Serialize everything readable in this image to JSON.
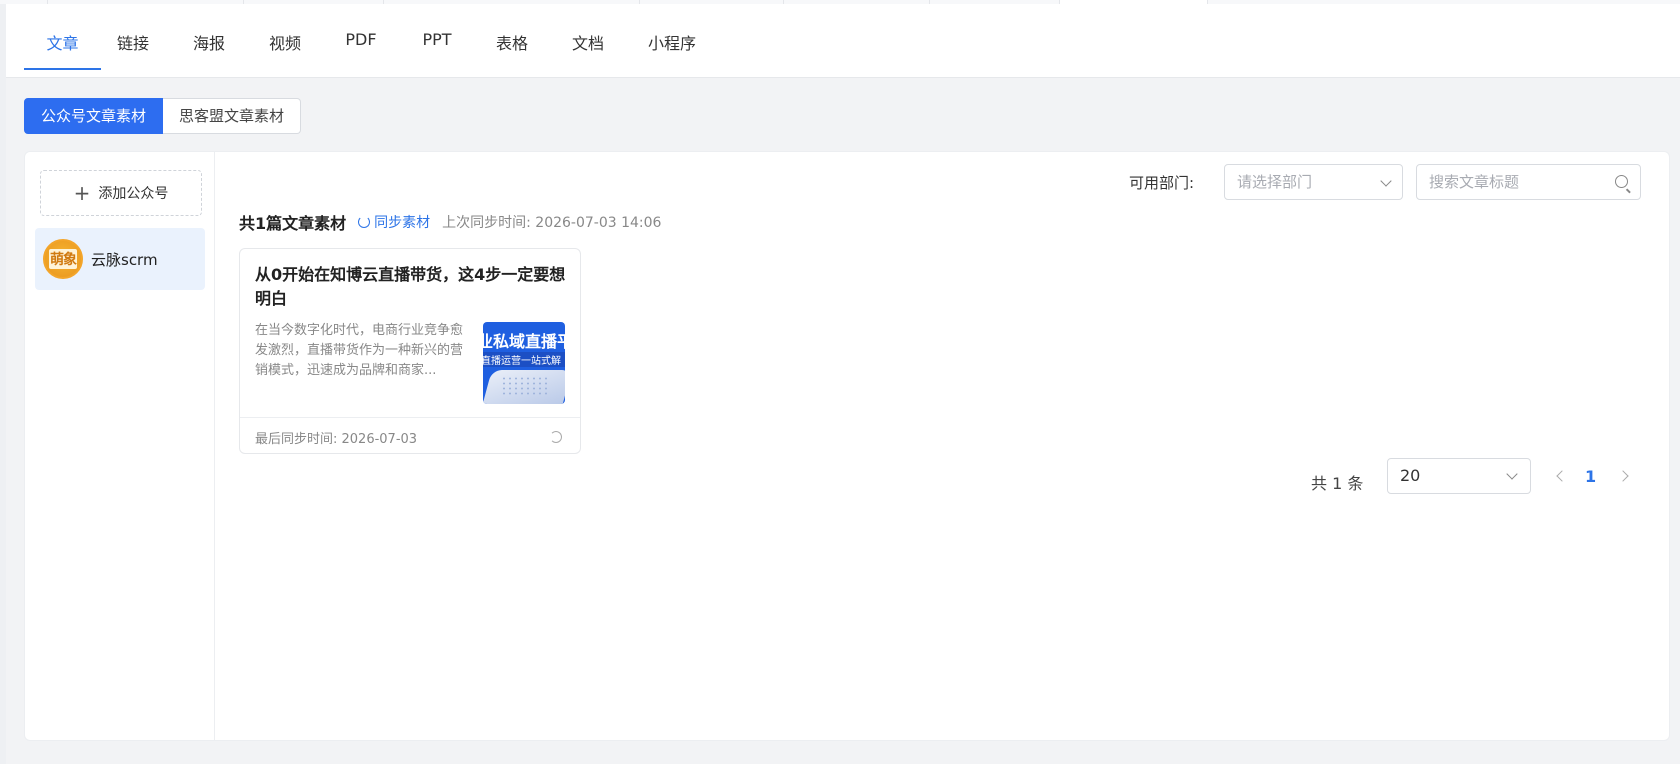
{
  "nav": {
    "tabs": [
      {
        "label": "文章"
      },
      {
        "label": "链接"
      },
      {
        "label": "海报"
      },
      {
        "label": "视频"
      },
      {
        "label": "PDF"
      },
      {
        "label": "PPT"
      },
      {
        "label": "表格"
      },
      {
        "label": "文档"
      },
      {
        "label": "小程序"
      }
    ],
    "active": "文章"
  },
  "source_tabs": {
    "items": [
      {
        "label": "公众号文章素材"
      },
      {
        "label": "思客盟文章素材"
      }
    ],
    "active": "公众号文章素材"
  },
  "sidebar": {
    "add_label": "添加公众号",
    "accounts": [
      {
        "name": "云脉scrm",
        "avatar_text": "萌象"
      }
    ]
  },
  "filters": {
    "department_label": "可用部门:",
    "department_placeholder": "请选择部门",
    "search_placeholder": "搜索文章标题"
  },
  "summary": {
    "count_text": "共1篇文章素材",
    "sync_label": "同步素材",
    "last_sync": "上次同步时间: 2026-07-03 14:06"
  },
  "articles": [
    {
      "title": "从0开始在知博云直播带货，这4步一定要想明白",
      "excerpt": "在当今数字化时代，电商行业竞争愈发激烈，直播带货作为一种新兴的营销模式，迅速成为品牌和商家...",
      "thumb_line1": "业私域直播平",
      "thumb_line2": "直播运营一站式解",
      "footer": "最后同步时间: 2026-07-03"
    }
  ],
  "pagination": {
    "total": "共 1 条",
    "page_size": "20",
    "current_page": "1"
  },
  "colors": {
    "accent": "#2d74e7",
    "segment_active": "#2d6df0",
    "background": "#f2f3f5"
  }
}
